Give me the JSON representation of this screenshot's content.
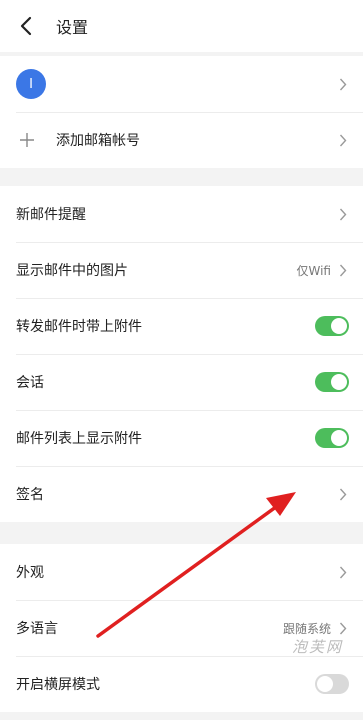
{
  "header": {
    "title": "设置"
  },
  "account": {
    "avatar_letter": "I",
    "add_account_label": "添加邮箱帐号"
  },
  "settings": {
    "new_mail_notify": "新邮件提醒",
    "show_images": "显示邮件中的图片",
    "show_images_value": "仅Wifi",
    "forward_attachments": "转发邮件时带上附件",
    "conversation": "会话",
    "list_show_attachments": "邮件列表上显示附件",
    "signature": "签名"
  },
  "toggles": {
    "forward_attachments": true,
    "conversation": true,
    "list_show_attachments": true,
    "landscape_mode": false
  },
  "display": {
    "appearance": "外观",
    "language": "多语言",
    "language_value": "跟随系统",
    "landscape_mode": "开启横屏模式"
  },
  "watermark": "泡芙网",
  "colors": {
    "toggle_on": "#4dbd5c",
    "toggle_off": "#d9d9d9",
    "avatar": "#3b77e6",
    "annotation_arrow": "#e02020"
  }
}
